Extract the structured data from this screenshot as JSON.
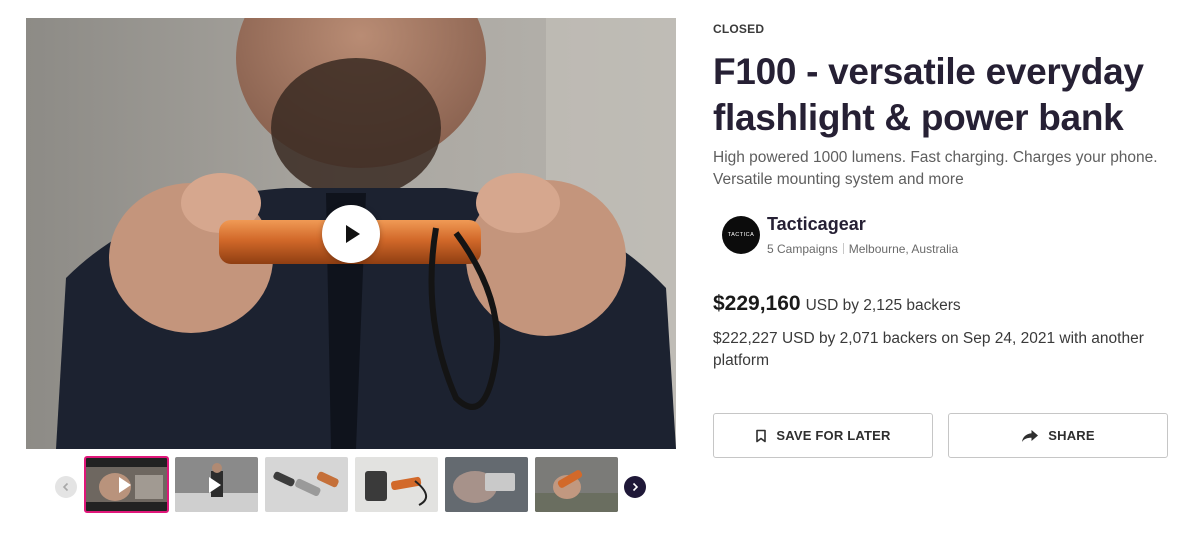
{
  "campaign": {
    "status": "CLOSED",
    "title": "F100 - versatile everyday flashlight & power bank",
    "blurb": "High powered 1000 lumens. Fast charging. Charges your phone. Versatile mounting system and more"
  },
  "creator": {
    "name": "Tacticagear",
    "avatar_text": "TACTICA",
    "campaigns": "5 Campaigns",
    "location": "Melbourne, Australia"
  },
  "funding": {
    "amount": "$229,160",
    "detail": "USD by 2,125 backers",
    "other_platform": "$222,227 USD by 2,071 backers on Sep 24, 2021 with another platform"
  },
  "actions": {
    "save_label": "SAVE FOR LATER",
    "share_label": "SHARE"
  },
  "gallery": {
    "thumbnails": [
      "video",
      "video",
      "image",
      "image",
      "image",
      "image"
    ],
    "active_index": 0
  },
  "colors": {
    "accent_pink": "#e0177a",
    "navy": "#1f1838",
    "product_orange": "#d2692a"
  }
}
